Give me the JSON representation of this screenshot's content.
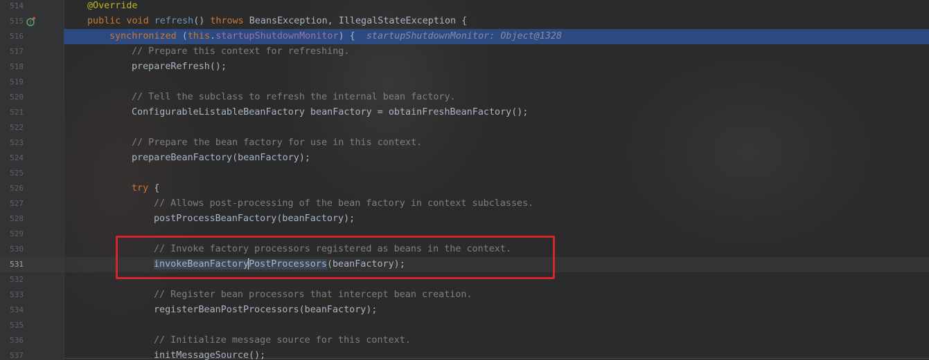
{
  "gutter": {
    "line_numbers": [
      "514",
      "515",
      "516",
      "517",
      "518",
      "519",
      "520",
      "521",
      "522",
      "523",
      "524",
      "525",
      "526",
      "527",
      "528",
      "529",
      "530",
      "531",
      "532",
      "533",
      "534",
      "535",
      "536",
      "537"
    ],
    "current_line": "531"
  },
  "code": {
    "l514": {
      "annotation": "@Override"
    },
    "l515": {
      "kw_public": "public",
      "kw_void": "void",
      "method": "refresh",
      "parens": "() ",
      "kw_throws": "throws",
      "rest": " BeansException, IllegalStateException {"
    },
    "l516": {
      "kw_sync": "synchronized",
      "open": " (",
      "kw_this": "this",
      "dot": ".",
      "field": "startupShutdownMonitor",
      "close": ") {",
      "inlay_hint": "startupShutdownMonitor: Object@1328"
    },
    "l517": "// Prepare this context for refreshing.",
    "l518": "prepareRefresh();",
    "l520": "// Tell the subclass to refresh the internal bean factory.",
    "l521": "ConfigurableListableBeanFactory beanFactory = obtainFreshBeanFactory();",
    "l523": "// Prepare the bean factory for use in this context.",
    "l524": "prepareBeanFactory(beanFactory);",
    "l526": {
      "kw_try": "try",
      "rest": " {"
    },
    "l527": "// Allows post-processing of the bean factory in context subclasses.",
    "l528": "postProcessBeanFactory(beanFactory);",
    "l530": "// Invoke factory processors registered as beans in the context.",
    "l531": {
      "before_caret": "invokeBeanFactory",
      "after_caret": "PostProcessors",
      "rest": "(beanFactory);"
    },
    "l533": "// Register bean processors that intercept bean creation.",
    "l534": "registerBeanPostProcessors(beanFactory);",
    "l536": "// Initialize message source for this context.",
    "l537": "initMessageSource();"
  },
  "colors": {
    "background": "#2b2b2b",
    "keyword": "#cc7832",
    "annotation": "#bbb529",
    "comment": "#808080",
    "field": "#9876aa",
    "method_decl": "#6897bb",
    "execution_line": "#2d4a80",
    "highlight_box": "#d8242c"
  },
  "icons": {
    "gutter_515": "override-method-icon"
  }
}
